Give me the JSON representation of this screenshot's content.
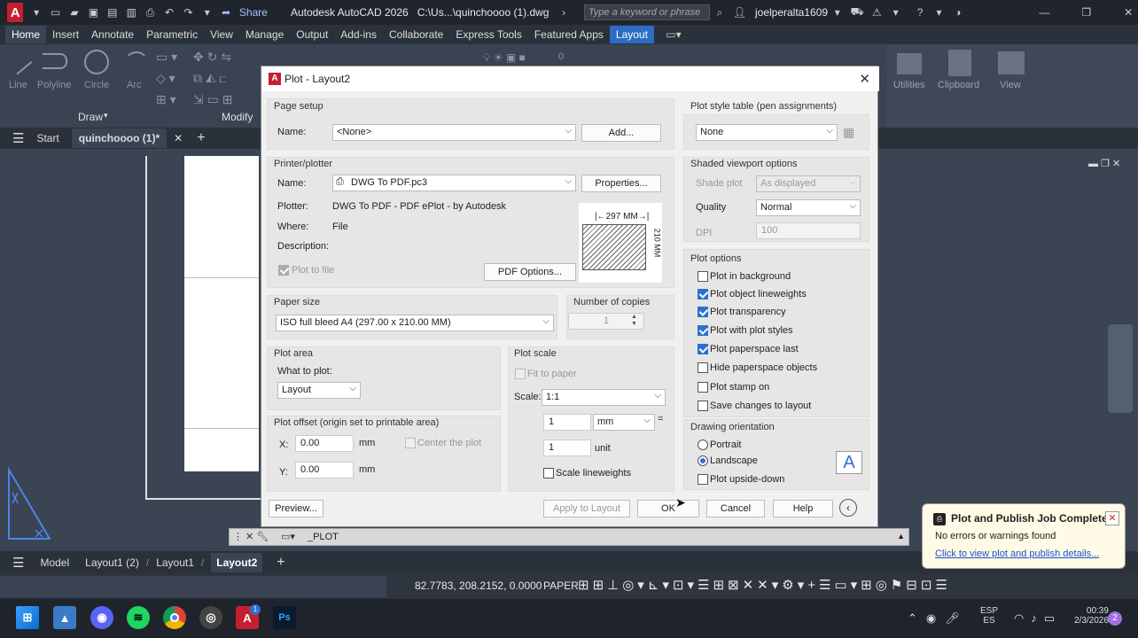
{
  "app": {
    "logo": "A",
    "share": "Share",
    "title": "Autodesk AutoCAD 2026",
    "path": "C:\\Us...\\quinchoooo (1).dwg",
    "search_placeholder": "Type a keyword or phrase",
    "user": "joelperalta1609"
  },
  "ribbon": {
    "tabs": [
      "Home",
      "Insert",
      "Annotate",
      "Parametric",
      "View",
      "Manage",
      "Output",
      "Add-ins",
      "Collaborate",
      "Express Tools",
      "Featured Apps",
      "Layout"
    ],
    "selected_tab": "Home",
    "draw_tools": [
      "Line",
      "Polyline",
      "Circle",
      "Arc"
    ],
    "panel_draw": "Draw",
    "panel_modify": "Modify",
    "right_tools": [
      "Utilities",
      "Clipboard",
      "View"
    ],
    "layer_value": "0"
  },
  "doc_tabs": {
    "start": "Start",
    "active": "quinchoooo (1)*"
  },
  "dialog": {
    "title": "Plot - Layout2",
    "page_setup": {
      "label": "Page setup",
      "name_label": "Name:",
      "name_value": "<None>",
      "add_button": "Add..."
    },
    "printer": {
      "label": "Printer/plotter",
      "name_label": "Name:",
      "name_value": "DWG To PDF.pc3",
      "properties_button": "Properties...",
      "plotter_label": "Plotter:",
      "plotter_value": "DWG To PDF - PDF ePlot - by Autodesk",
      "where_label": "Where:",
      "where_value": "File",
      "description_label": "Description:",
      "plot_to_file": "Plot to file",
      "pdf_options_button": "PDF Options...",
      "preview_width": "297",
      "preview_height": "210",
      "preview_unit": "MM"
    },
    "paper_size": {
      "label": "Paper size",
      "value": "ISO full bleed A4 (297.00 x 210.00 MM)"
    },
    "copies": {
      "label": "Number of copies",
      "value": "1"
    },
    "plot_area": {
      "label": "Plot area",
      "what_label": "What to plot:",
      "what_value": "Layout"
    },
    "plot_offset": {
      "label": "Plot offset (origin set to printable area)",
      "x_label": "X:",
      "x_value": "0.00",
      "y_label": "Y:",
      "y_value": "0.00",
      "unit": "mm",
      "center": "Center the plot"
    },
    "plot_scale": {
      "label": "Plot scale",
      "fit": "Fit to paper",
      "scale_label": "Scale:",
      "scale_value": "1:1",
      "top_value": "1",
      "top_unit": "mm",
      "eq": "=",
      "bottom_value": "1",
      "bottom_unit": "unit",
      "scale_lw": "Scale lineweights"
    },
    "style_table": {
      "label": "Plot style table (pen assignments)",
      "value": "None"
    },
    "shaded": {
      "label": "Shaded viewport options",
      "shade_label": "Shade plot",
      "shade_value": "As displayed",
      "quality_label": "Quality",
      "quality_value": "Normal",
      "dpi_label": "DPI",
      "dpi_value": "100"
    },
    "options": {
      "label": "Plot options",
      "items": [
        {
          "label": "Plot in background",
          "checked": false
        },
        {
          "label": "Plot object lineweights",
          "checked": true
        },
        {
          "label": "Plot transparency",
          "checked": true
        },
        {
          "label": "Plot with plot styles",
          "checked": true
        },
        {
          "label": "Plot paperspace last",
          "checked": true
        },
        {
          "label": "Hide paperspace objects",
          "checked": false
        },
        {
          "label": "Plot stamp on",
          "checked": false
        },
        {
          "label": "Save changes to layout",
          "checked": false
        }
      ]
    },
    "orientation": {
      "label": "Drawing orientation",
      "portrait": "Portrait",
      "landscape": "Landscape",
      "upside_down": "Plot upside-down",
      "selected": "Landscape"
    },
    "buttons": {
      "preview": "Preview...",
      "apply": "Apply to Layout",
      "ok": "OK",
      "cancel": "Cancel",
      "help": "Help"
    }
  },
  "command": {
    "text": "_PLOT"
  },
  "layout_tabs": [
    "Model",
    "Layout1 (2)",
    "Layout1",
    "Layout2"
  ],
  "active_layout": "Layout2",
  "status": {
    "coords": "82.7783, 208.2152, 0.0000",
    "space": "PAPER"
  },
  "notification": {
    "title": "Plot and Publish Job Complete",
    "message": "No errors or warnings found",
    "link": "Click to view plot and publish details..."
  },
  "taskbar": {
    "lang": "ESP",
    "lang2": "ES",
    "time": "00:39",
    "date": "2/3/2026",
    "badge": "2",
    "acad_badge": "1"
  },
  "colors": {
    "accent": "#2b6cc4",
    "check": "#2f6ed1",
    "title_bar": "#20242c"
  }
}
